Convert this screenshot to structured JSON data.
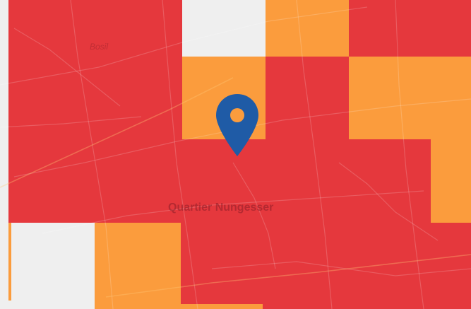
{
  "map": {
    "labels": {
      "quartier": "Quartier Nungesser",
      "bosil": "Bosil"
    },
    "marker_icon": "map-pin-icon",
    "colors": {
      "high": "#e5383d",
      "medium": "#fb9c3d",
      "none": "#efefef",
      "marker": "#1f5ba6"
    }
  }
}
